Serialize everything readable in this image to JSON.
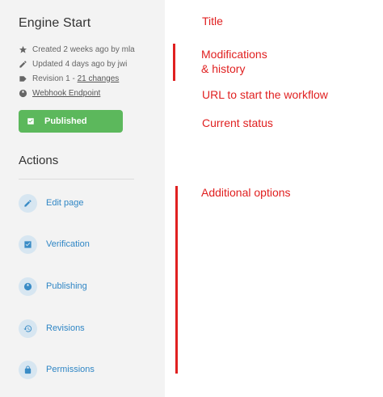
{
  "panel": {
    "title": "Engine Start",
    "meta": {
      "created": "Created 2 weeks ago by mla",
      "updated": "Updated 4 days ago by jwi",
      "revision_prefix": "Revision 1 - ",
      "revision_link": "21 changes",
      "webhook": "Webhook Endpoint"
    },
    "status_label": "Published",
    "status_color": "#5cb85c",
    "actions_title": "Actions",
    "actions": [
      {
        "label": "Edit page",
        "icon": "pencil-icon"
      },
      {
        "label": "Verification",
        "icon": "checkbox-icon"
      },
      {
        "label": "Publishing",
        "icon": "globe-icon"
      },
      {
        "label": "Revisions",
        "icon": "history-icon"
      },
      {
        "label": "Permissions",
        "icon": "lock-icon"
      }
    ]
  },
  "annotations": {
    "title": "Title",
    "modifications_line1": "Modifications",
    "modifications_line2": "& history",
    "url": "URL to start the workflow",
    "status": "Current status",
    "additional": "Additional options",
    "color": "#e02020"
  }
}
